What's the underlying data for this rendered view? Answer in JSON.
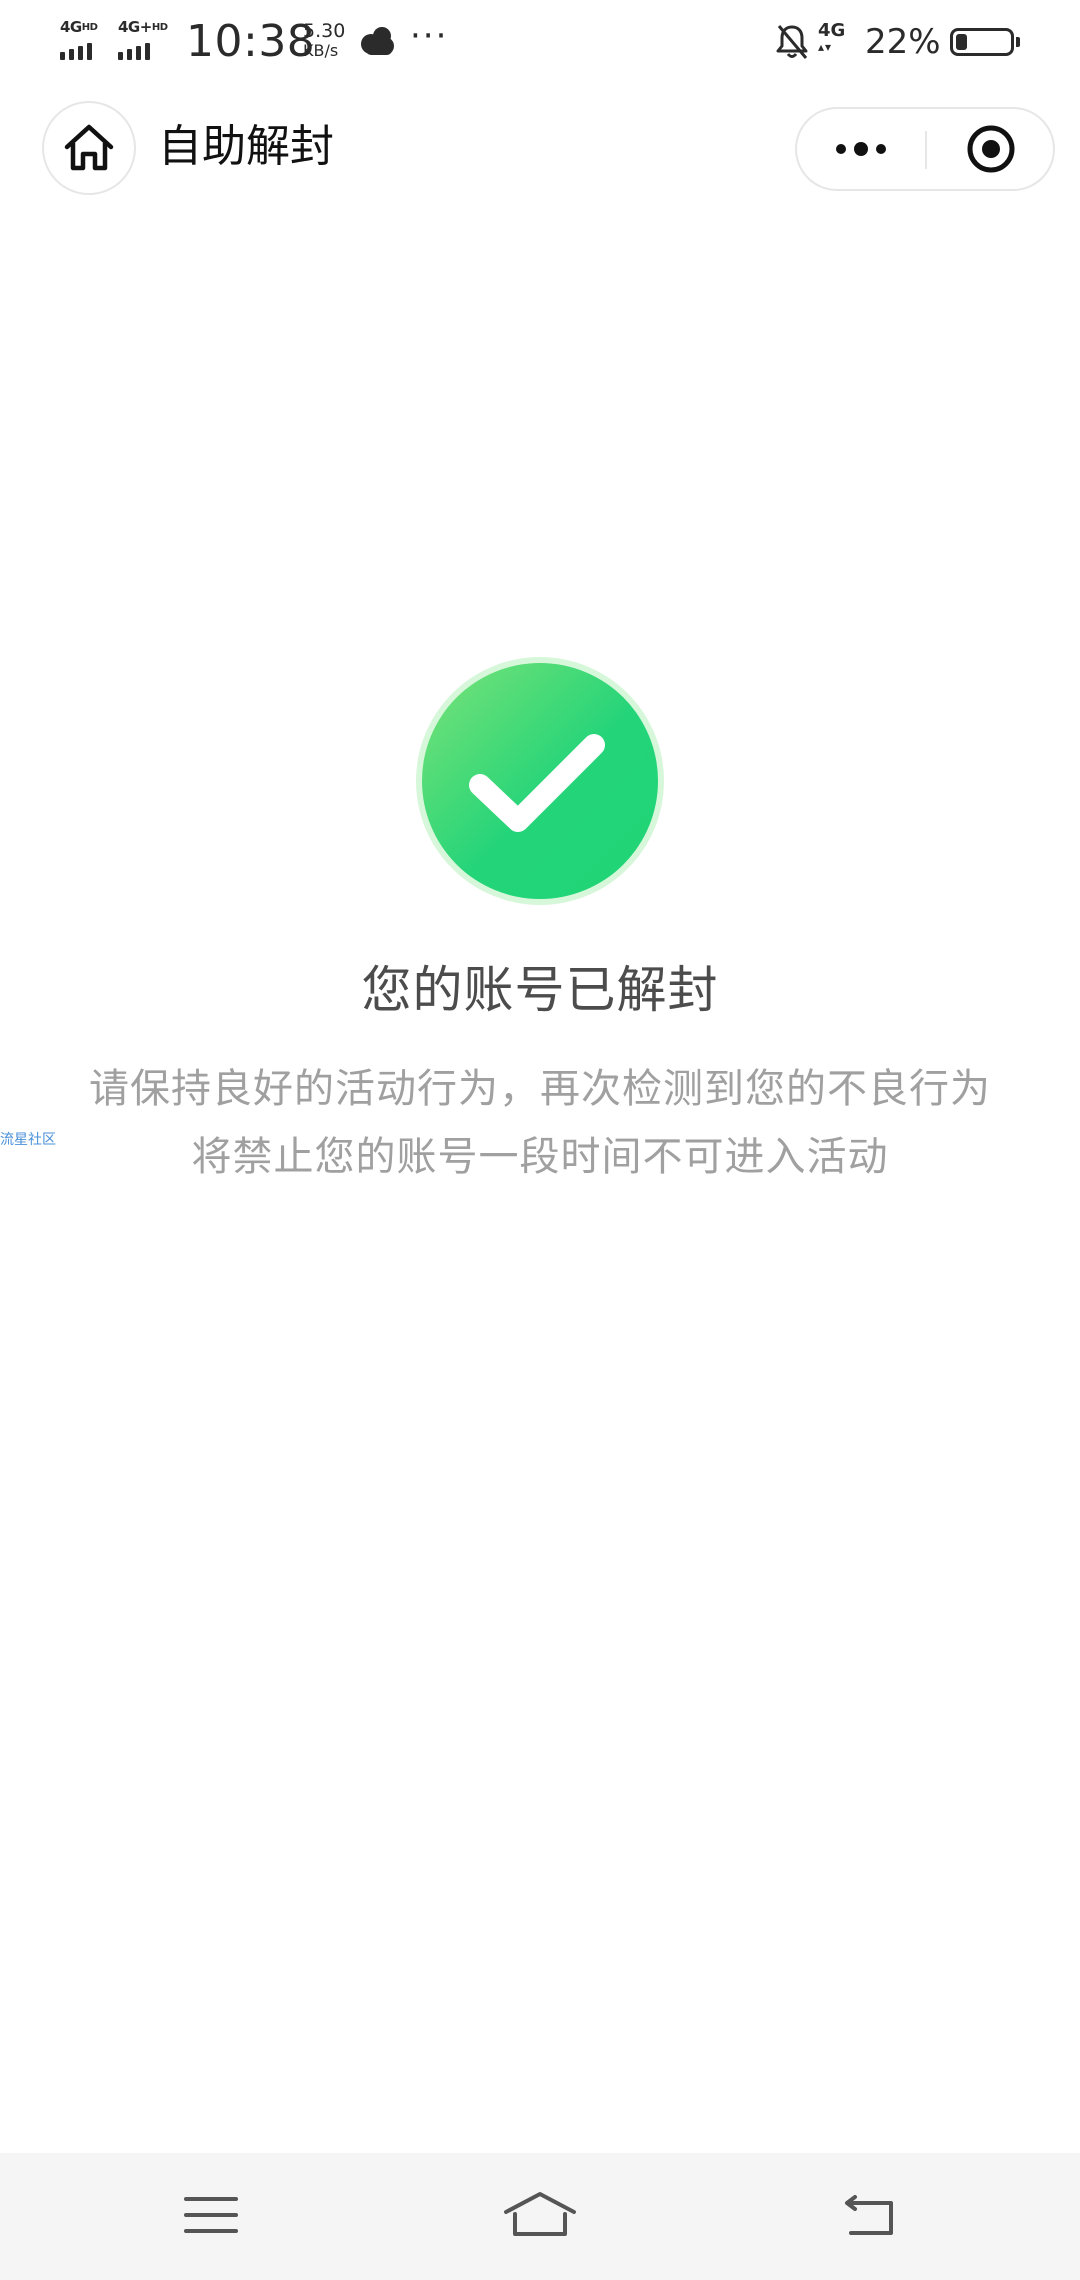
{
  "status_bar": {
    "sim1_label": "4G",
    "sim1_sup": "HD",
    "sim2_label": "4G+",
    "sim2_sup": "HD",
    "time": "10:38",
    "speed_value": "5.30",
    "speed_unit": "KB/s",
    "overflow": "···",
    "data_type": "4G",
    "data_arrows": "▴▾",
    "battery_percent": "22%",
    "battery_level": 0.22,
    "icons": [
      "signal-icon",
      "weather-cloud-icon",
      "bell-muted-icon",
      "battery-icon"
    ]
  },
  "nav": {
    "title": "自助解封",
    "home_icon": "home-icon",
    "more_icon": "more-dots-icon",
    "close_icon": "target-close-icon"
  },
  "result": {
    "title": "您的账号已解封",
    "desc_line1": "请保持良好的活动行为，再次检测到您的不良行为",
    "desc_line2": "将禁止您的账号一段时间不可进入活动",
    "icon": "check-circle-icon",
    "colors": {
      "success_start": "#6fe07a",
      "success_end": "#1fd676",
      "title": "#4c4c4c",
      "desc": "#a0a0a0"
    }
  },
  "watermark": "流星社区",
  "system_nav": {
    "menu_icon": "menu-icon",
    "home_icon": "home-outline-icon",
    "back_icon": "back-icon"
  }
}
